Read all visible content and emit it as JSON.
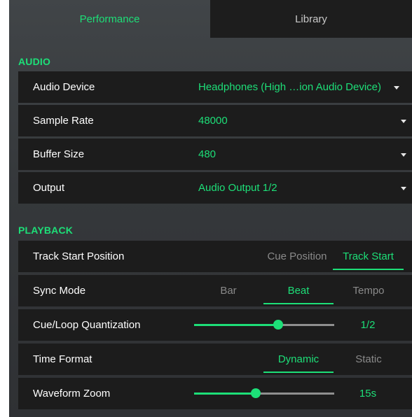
{
  "tabs": [
    {
      "label": "Performance",
      "active": true
    },
    {
      "label": "Library",
      "active": false
    }
  ],
  "audio": {
    "title": "AUDIO",
    "rows": [
      {
        "label": "Audio Device",
        "value": "Headphones (High …ion Audio Device)"
      },
      {
        "label": "Sample Rate",
        "value": "48000"
      },
      {
        "label": "Buffer Size",
        "value": "480"
      },
      {
        "label": "Output",
        "value": "Audio Output 1/2"
      }
    ]
  },
  "playback": {
    "title": "PLAYBACK",
    "track_start": {
      "label": "Track Start Position",
      "options": [
        "Cue Position",
        "Track Start"
      ],
      "selected": "Track Start"
    },
    "sync_mode": {
      "label": "Sync Mode",
      "options": [
        "Bar",
        "Beat",
        "Tempo"
      ],
      "selected": "Beat"
    },
    "quantization": {
      "label": "Cue/Loop Quantization",
      "value": "1/2",
      "level": 0.6
    },
    "time_format": {
      "label": "Time Format",
      "options": [
        "Dynamic",
        "Static"
      ],
      "selected": "Dynamic"
    },
    "waveform_zoom": {
      "label": "Waveform Zoom",
      "value": "15s",
      "level": 0.44
    }
  },
  "colors": {
    "accent": "#1ddf78",
    "row_bg": "#1c1c1c",
    "panel_bg": "#3b3e41"
  },
  "icons": {
    "dropdown_caret": "caret-down-icon"
  }
}
